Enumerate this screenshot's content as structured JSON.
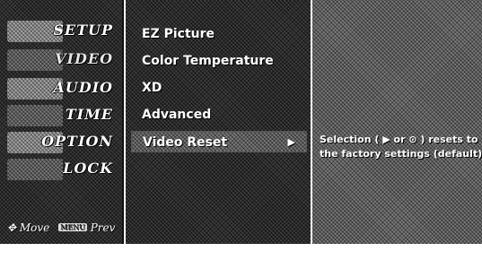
{
  "left_menu": {
    "items": [
      {
        "label": "SETUP"
      },
      {
        "label": "VIDEO"
      },
      {
        "label": "AUDIO"
      },
      {
        "label": "TIME"
      },
      {
        "label": "OPTION"
      },
      {
        "label": "LOCK"
      }
    ],
    "active_index": 1
  },
  "help": {
    "move_icon": "dpad-icon",
    "move_label": "Move",
    "menu_key": "MENU",
    "prev_label": "Prev"
  },
  "submenu": {
    "items": [
      {
        "label": "EZ Picture"
      },
      {
        "label": "Color Temperature"
      },
      {
        "label": "XD"
      },
      {
        "label": "Advanced"
      },
      {
        "label": "Video Reset"
      }
    ],
    "selected_index": 4,
    "arrow_icon": "right-triangle-icon"
  },
  "info_panel": {
    "line1": "Selection ( ▶ or ⊙ ) resets to",
    "line2": "the factory settings (default)."
  }
}
